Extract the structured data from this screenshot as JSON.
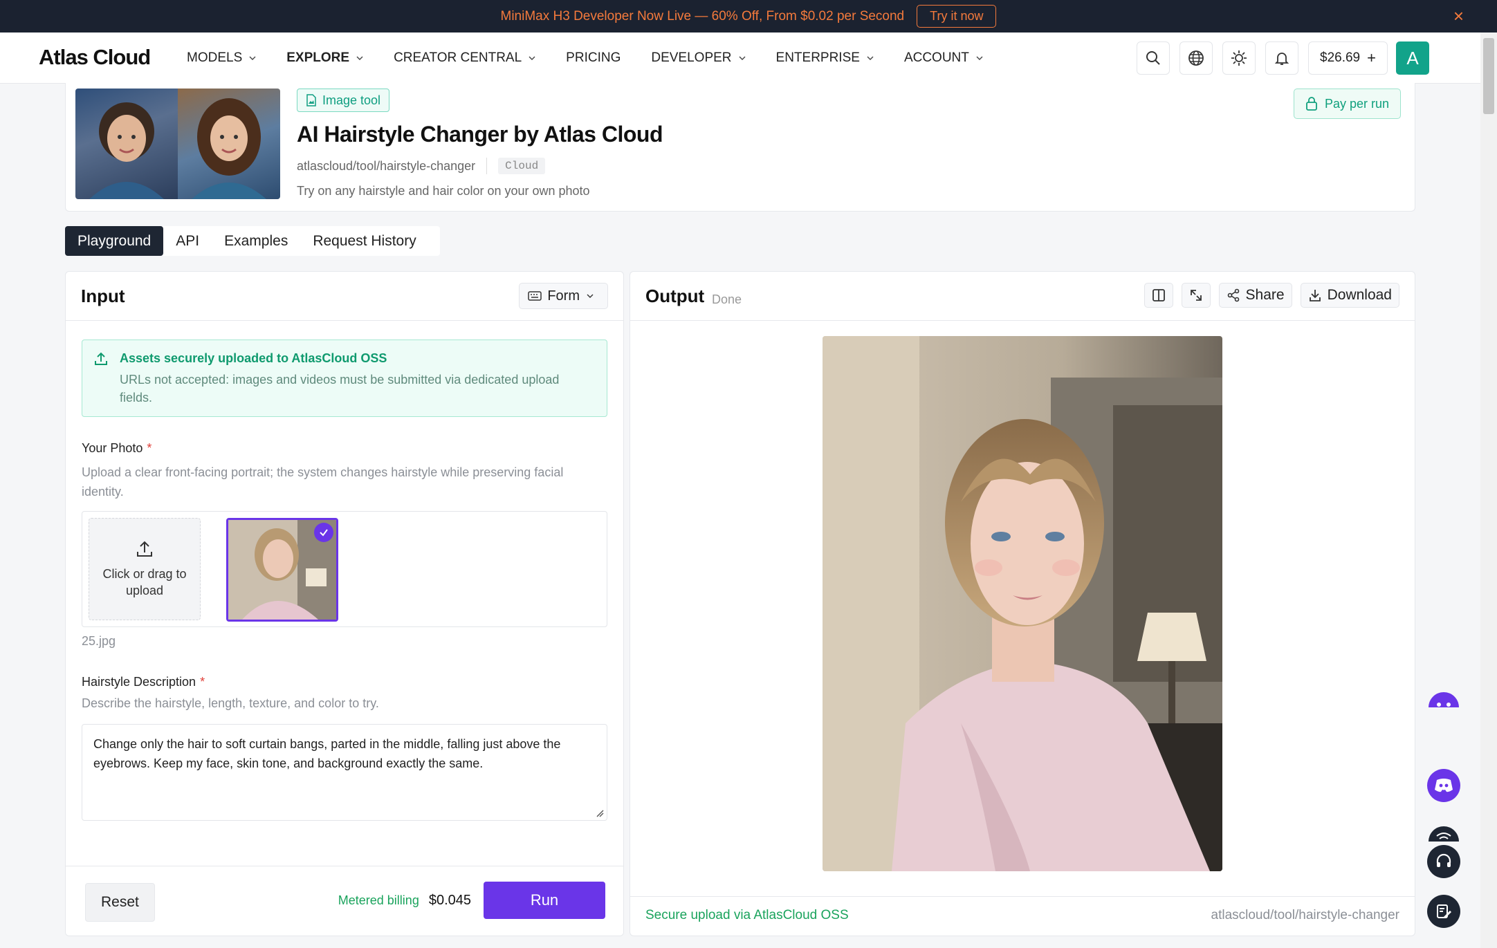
{
  "banner": {
    "text": "MiniMax H3 Developer Now Live — 60% Off, From $0.02 per Second",
    "cta": "Try it now",
    "close": "×"
  },
  "nav": {
    "logo": "Atlas Cloud",
    "items": [
      {
        "label": "MODELS",
        "dropdown": true
      },
      {
        "label": "EXPLORE",
        "dropdown": true,
        "active": true
      },
      {
        "label": "CREATOR CENTRAL",
        "dropdown": true
      },
      {
        "label": "PRICING",
        "dropdown": false
      },
      {
        "label": "DEVELOPER",
        "dropdown": true
      },
      {
        "label": "ENTERPRISE",
        "dropdown": true
      },
      {
        "label": "ACCOUNT",
        "dropdown": true
      }
    ],
    "balance": "$26.69",
    "balance_plus": "+",
    "avatar": "A"
  },
  "header": {
    "tag": "Image tool",
    "title": "AI Hairstyle Changer by Atlas Cloud",
    "slug": "atlascloud/tool/hairstyle-changer",
    "chip": "Cloud",
    "description": "Try on any hairstyle and hair color on your own photo",
    "pay_button": "Pay per run"
  },
  "tabs": [
    "Playground",
    "API",
    "Examples",
    "Request History"
  ],
  "input": {
    "title": "Input",
    "mode": "Form",
    "notice_title": "Assets securely uploaded to AtlasCloud OSS",
    "notice_body": "URLs not accepted: images and videos must be submitted via dedicated upload fields.",
    "photo_label": "Your Photo",
    "photo_help": "Upload a clear front-facing portrait; the system changes hairstyle while preserving facial identity.",
    "upload_text": "Click or drag to upload",
    "filename": "25.jpg",
    "hair_label": "Hairstyle Description",
    "hair_help": "Describe the hairstyle, length, texture, and color to try.",
    "hair_value": "Change only the hair to soft curtain bangs, parted in the middle, falling just above the eyebrows. Keep my face, skin tone, and background exactly the same.",
    "required_mark": "*",
    "reset": "Reset",
    "billing": "Metered billing",
    "price": "$0.045",
    "run": "Run"
  },
  "output": {
    "title": "Output",
    "status": "Done",
    "share": "Share",
    "download": "Download",
    "secure": "Secure upload via AtlasCloud OSS",
    "path": "atlascloud/tool/hairstyle-changer"
  },
  "colors": {
    "accent": "#6a35e8",
    "brand_green": "#12a38a",
    "banner_orange": "#f47a3c"
  }
}
